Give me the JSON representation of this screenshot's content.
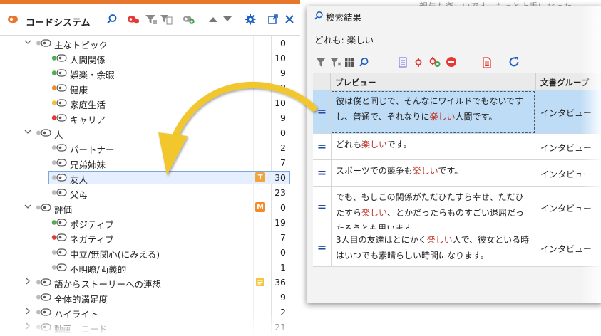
{
  "code_system": {
    "title": "コードシステム",
    "rows": [
      {
        "label": "主なトピック",
        "count": "0",
        "level": 1,
        "expanded": true,
        "color": ""
      },
      {
        "label": "人間関係",
        "count": "10",
        "level": 2,
        "color": "#4caf50"
      },
      {
        "label": "娯楽・余暇",
        "count": "9",
        "level": 2,
        "color": "#4caf50"
      },
      {
        "label": "健康",
        "count": "8",
        "level": 2,
        "color": "#f28c28"
      },
      {
        "label": "家庭生活",
        "count": "10",
        "level": 2,
        "color": "#f2c12e"
      },
      {
        "label": "キャリア",
        "count": "9",
        "level": 2,
        "color": "#e53935"
      },
      {
        "label": "人",
        "count": "0",
        "level": 1,
        "expanded": true,
        "color": ""
      },
      {
        "label": "パートナー",
        "count": "2",
        "level": 2,
        "color": "#bbbbbb"
      },
      {
        "label": "兄弟姉妹",
        "count": "7",
        "level": 2,
        "color": "#bbbbbb"
      },
      {
        "label": "友人",
        "count": "30",
        "level": 2,
        "color": "#bbbbbb",
        "badge": "T",
        "selected": true
      },
      {
        "label": "父母",
        "count": "23",
        "level": 2,
        "color": "#bbbbbb"
      },
      {
        "label": "評価",
        "count": "0",
        "level": 1,
        "expanded": true,
        "color": "",
        "badge": "M"
      },
      {
        "label": "ポジティブ",
        "count": "19",
        "level": 2,
        "color": "#4caf50"
      },
      {
        "label": "ネガティブ",
        "count": "7",
        "level": 2,
        "color": "#e53935"
      },
      {
        "label": "中立/無関心(にみえる)",
        "count": "0",
        "level": 2,
        "color": "#bbbbbb"
      },
      {
        "label": "不明瞭/両義的",
        "count": "1",
        "level": 2,
        "color": "#bbbbbb"
      },
      {
        "label": "語からストーリーへの連想",
        "count": "36",
        "level": 1,
        "expanded": false,
        "color": "",
        "badge": "memo"
      },
      {
        "label": "全体的満足度",
        "count": "9",
        "level": 1,
        "expanded": false,
        "color": "",
        "nochev": true
      },
      {
        "label": "ハイライト",
        "count": "2",
        "level": 1,
        "expanded": false,
        "color": ""
      },
      {
        "label": "動画 - コード",
        "count": "21",
        "level": 1,
        "expanded": false,
        "color": ""
      }
    ]
  },
  "search_results": {
    "title": "検索結果",
    "query": "どれも: 楽しい",
    "columns": {
      "preview": "プレビュー",
      "docgroup": "文書グループ"
    },
    "rows": [
      {
        "pre": "彼は僕と同じで、そんなにワイルドでもないですし、普通で、それなりに",
        "hit": "楽しい",
        "post": "人間です。",
        "doc": "インタビュー",
        "selected": true
      },
      {
        "pre": "どれも",
        "hit": "楽しい",
        "post": "です。",
        "doc": "インタビュー"
      },
      {
        "pre": "スポーツでの競争も",
        "hit": "楽しい",
        "post": "です。",
        "doc": "インタビュー"
      },
      {
        "pre": "でも、もしこの関係がただひたすら幸せ、ただひたすら",
        "hit": "楽しい",
        "post": "、とかだったらものすごい退屈だったろうとも思います。",
        "doc": "インタビュー"
      },
      {
        "pre": "3人目の友達はとにかく",
        "hit": "楽しい",
        "post": "人で、彼女といる時はいつでも素晴らしい時間になります。",
        "doc": "インタビュー"
      }
    ]
  },
  "background_text": "親与も楽しいです。もっと上手になった",
  "colors": {
    "accent_orange": "#e8772e",
    "selection_blue": "#bfdcf7",
    "hit_red": "#c0392b",
    "arrow_yellow": "#f2c72e"
  }
}
